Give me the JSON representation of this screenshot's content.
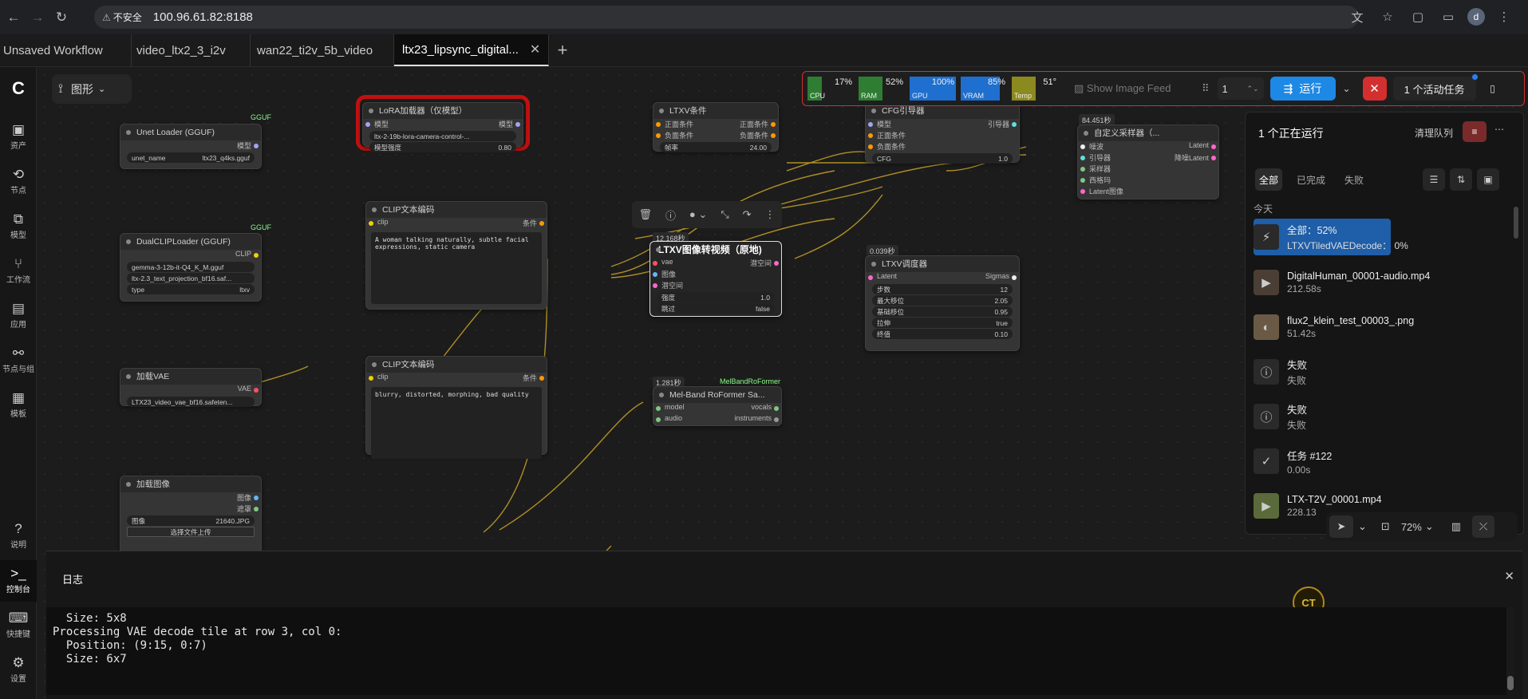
{
  "browser": {
    "insecure": "不安全",
    "url": "100.96.61.82:8188",
    "profile": "d"
  },
  "tabs": [
    "Unsaved Workflow",
    "video_ltx2_3_i2v",
    "wan22_ti2v_5b_video",
    "ltx23_lipsync_digital..."
  ],
  "sidebar": [
    {
      "label": "资产",
      "icon": "image-icon"
    },
    {
      "label": "节点",
      "icon": "node-icon"
    },
    {
      "label": "模型",
      "icon": "model-icon"
    },
    {
      "label": "工作流",
      "icon": "workflow-icon"
    },
    {
      "label": "应用",
      "icon": "app-icon"
    },
    {
      "label": "节点与组",
      "icon": "group-icon"
    },
    {
      "label": "模板",
      "icon": "template-icon"
    },
    {
      "label": "说明",
      "icon": "help-icon"
    },
    {
      "label": "控制台",
      "icon": "console-icon"
    },
    {
      "label": "快捷键",
      "icon": "keyboard-icon"
    },
    {
      "label": "设置",
      "icon": "gear-icon"
    }
  ],
  "graph_button": "图形",
  "monitor": {
    "cpu": {
      "label": "CPU",
      "value": "17%",
      "level": 0.17,
      "color": "#2e7d32"
    },
    "ram": {
      "label": "RAM",
      "value": "52%",
      "level": 0.52,
      "color": "#2e7d32"
    },
    "gpu": {
      "label": "GPU",
      "value": "100%",
      "level": 1.0,
      "color": "#1e6fcf"
    },
    "vram": {
      "label": "VRAM",
      "value": "85%",
      "level": 0.85,
      "color": "#1e6fcf"
    },
    "temp": {
      "label": "Temp",
      "value": "51°",
      "level": 0.51,
      "color": "#8a8a1e"
    },
    "image_feed": "Show Image Feed",
    "batch": "1",
    "run": "运行",
    "active": "1 个活动任务"
  },
  "queue": {
    "title": "1 个正在运行",
    "clear": "清理队列",
    "filters": [
      "全部",
      "已完成",
      "失败"
    ],
    "section": "今天",
    "items": [
      {
        "name": "全部：52%",
        "sub": "LTXVTiledVAEDecode： 0%",
        "icon": "bolt-icon",
        "progress": 0.52
      },
      {
        "name": "DigitalHuman_00001-audio.mp4",
        "sub": "212.58s",
        "icon": "video-thumb"
      },
      {
        "name": "flux2_klein_test_00003_.png",
        "sub": "51.42s",
        "icon": "image-thumb"
      },
      {
        "name": "失败",
        "sub": "失败",
        "icon": "error-icon"
      },
      {
        "name": "失败",
        "sub": "失败",
        "icon": "error-icon"
      },
      {
        "name": "任务 #122",
        "sub": "0.00s",
        "icon": "check-icon"
      },
      {
        "name": "LTX-T2V_00001.mp4",
        "sub": "228.13",
        "icon": "video-thumb"
      }
    ],
    "zoom": "72%"
  },
  "nodes": {
    "unet": {
      "title": "Unet Loader (GGUF)",
      "tag": "GGUF",
      "out": "模型",
      "w_name": "unet_name",
      "w_val": "ltx23_q4ks.gguf"
    },
    "dualclip": {
      "title": "DualCLIPLoader (GGUF)",
      "tag": "GGUF",
      "out": "CLIP",
      "w1": "gemma-3-12b-it-Q4_K_M.gguf",
      "w2": "ltx-2.3_text_projection_bf16.saf...",
      "w3l": "type",
      "w3v": "ltxv"
    },
    "vae": {
      "title": "加载VAE",
      "out": "VAE",
      "w": "LTX23_video_vae_bf16.safeten..."
    },
    "loadimg": {
      "title": "加载图像",
      "o1": "图像",
      "o2": "遮罩",
      "wl": "图像",
      "wv": "21640.JPG",
      "upload": "选择文件上传"
    },
    "lora": {
      "title": "LoRA加载器（仅模型）",
      "in": "模型",
      "out": "模型",
      "w1": "ltx-2-19b-lora-camera-control-...",
      "w2l": "模型强度",
      "w2v": "0.80"
    },
    "clip1": {
      "title": "CLIP文本编码",
      "in": "clip",
      "out": "条件",
      "text": "A woman talking naturally, subtle facial expressions, static camera"
    },
    "clip2": {
      "title": "CLIP文本编码",
      "in": "clip",
      "out": "条件",
      "text": "blurry, distorted, morphing, bad quality"
    },
    "ltxvcond": {
      "title": "LTXV条件",
      "i1": "正面条件",
      "i2": "负面条件",
      "o1": "正面条件",
      "o2": "负面条件",
      "wl": "帧率",
      "wv": "24.00"
    },
    "i2v": {
      "title": "LTXV图像转视频（原地)",
      "time": "12.168秒",
      "i1": "vae",
      "i2": "图像",
      "i3": "潜空间",
      "out": "潜空间",
      "w1l": "强度",
      "w1v": "1.0",
      "w2l": "跳过",
      "w2v": "false"
    },
    "melband": {
      "title": "Mel-Band RoFormer Sa...",
      "time": "1.281秒",
      "tag": "MelBandRoFormer",
      "i1": "model",
      "i2": "audio",
      "o1": "vocals",
      "o2": "instruments"
    },
    "cfg": {
      "title": "CFG引导器",
      "i1": "模型",
      "i2": "正面条件",
      "i3": "负面条件",
      "out": "引导器",
      "wl": "CFG",
      "wv": "1.0"
    },
    "sched": {
      "title": "LTXV调度器",
      "time": "0.039秒",
      "in": "Latent",
      "out": "Sigmas",
      "w": [
        [
          "步数",
          "12"
        ],
        [
          "最大移位",
          "2.05"
        ],
        [
          "基础移位",
          "0.95"
        ],
        [
          "拉伸",
          "true"
        ],
        [
          "终值",
          "0.10"
        ]
      ]
    },
    "sampler": {
      "title": "自定义采样器（...",
      "time": "84.451秒",
      "i": [
        "噪波",
        "引导器",
        "采样器",
        "西格玛",
        "Latent图像"
      ],
      "o1": "Latent",
      "o2": "降噪Latent"
    }
  },
  "log": {
    "title": "日志",
    "lines": [
      "  Size: 5x8",
      "Processing VAE decode tile at row 3, col 0:",
      "  Position: (9:15, 0:7)",
      "  Size: 6x7"
    ]
  },
  "ct_badge": "CT"
}
